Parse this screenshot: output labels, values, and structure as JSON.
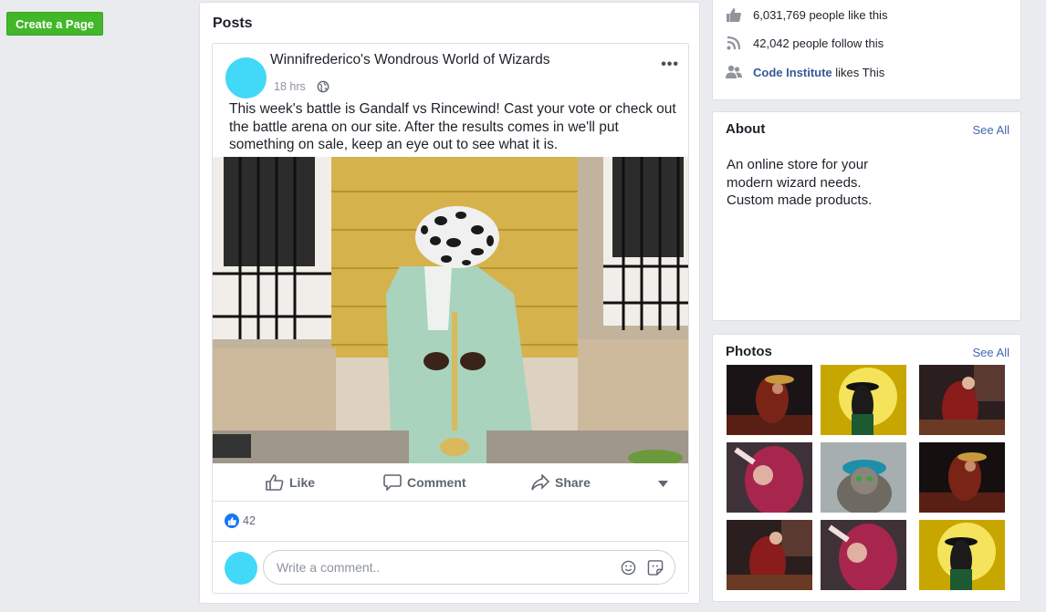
{
  "left": {
    "create_page_label": "Create a Page"
  },
  "posts": {
    "heading": "Posts",
    "post": {
      "page_name": "Winnifrederico's Wondrous World of Wizards",
      "time": "18 hrs",
      "text": "This week's battle is Gandalf vs Rincewind! Cast your vote or check out the battle arena on our site. After the results comes in we'll put something on sale, keep an eye out to see what it is.",
      "actions": {
        "like": "Like",
        "comment": "Comment",
        "share": "Share"
      },
      "like_count": "42",
      "comment_placeholder": "Write a comment.."
    }
  },
  "sidebar": {
    "stats": {
      "likes": "6,031,769 people like this",
      "follows": "42,042 people follow this",
      "liked_by_name": "Code Institute",
      "liked_by_suffix": " likes This"
    },
    "about": {
      "title": "About",
      "see_all": "See All",
      "description": "An online store for your modern wizard needs. Custom made products."
    },
    "photos": {
      "title": "Photos",
      "see_all": "See All"
    }
  },
  "colors": {
    "accent_green": "#42b72a",
    "link_blue": "#385898",
    "avatar_cyan": "#42d8f8"
  }
}
